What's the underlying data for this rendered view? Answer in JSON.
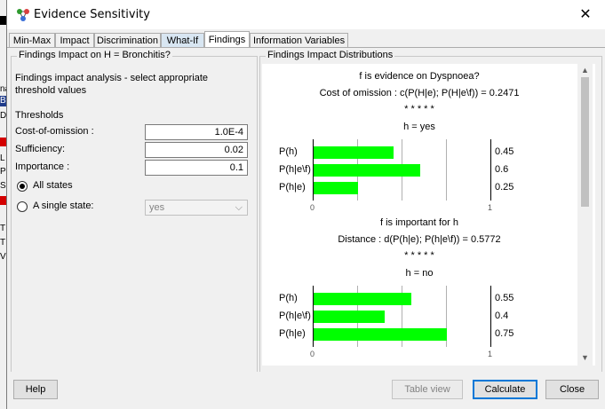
{
  "window": {
    "title": "Evidence Sensitivity",
    "close_glyph": "✕"
  },
  "background": {
    "letters": [
      "na",
      "Bi",
      "D",
      "",
      "L",
      "Pi",
      "Si",
      "",
      "T",
      "T",
      "V"
    ]
  },
  "tabs": [
    {
      "label": "Min-Max"
    },
    {
      "label": "Impact"
    },
    {
      "label": "Discrimination"
    },
    {
      "label": "What-If"
    },
    {
      "label": "Findings",
      "selected": true
    },
    {
      "label": "Information Variables"
    }
  ],
  "left_panel": {
    "title": "Findings Impact on H = Bronchitis?",
    "description": "Findings impact analysis - select appropriate threshold values",
    "thresholds_label": "Thresholds",
    "cost_of_omission": {
      "label": "Cost-of-omission :",
      "value": "1.0E-4"
    },
    "sufficiency": {
      "label": "Sufficiency:",
      "value": "0.02"
    },
    "importance": {
      "label": "Importance :",
      "value": "0.1"
    },
    "all_states": {
      "label": "All states",
      "selected": true
    },
    "single_state": {
      "label": "A single state:",
      "selected": false,
      "value": "yes"
    }
  },
  "right_panel": {
    "title": "Findings Impact Distributions",
    "sections": [
      {
        "heading": "f is evidence on Dyspnoea?",
        "metric": "Cost of omission : c(P(H|e); P(H|e\\f)) = 0.2471",
        "stars": "* * * * *",
        "state": "h = yes",
        "rows": [
          {
            "label": "P(h)",
            "value": 0.45,
            "value_text": "0.45"
          },
          {
            "label": "P(h|e\\f)",
            "value": 0.6,
            "value_text": "0.6"
          },
          {
            "label": "P(h|e)",
            "value": 0.25,
            "value_text": "0.25"
          }
        ],
        "axis_min": "0",
        "axis_max": "1"
      },
      {
        "heading": "f is important for h",
        "metric": "Distance : d(P(h|e); P(h|e\\f)) = 0.5772",
        "stars": "* * * * *",
        "state": "h = no",
        "rows": [
          {
            "label": "P(h)",
            "value": 0.55,
            "value_text": "0.55"
          },
          {
            "label": "P(h|e\\f)",
            "value": 0.4,
            "value_text": "0.4"
          },
          {
            "label": "P(h|e)",
            "value": 0.75,
            "value_text": "0.75"
          }
        ],
        "axis_min": "0",
        "axis_max": "1"
      }
    ],
    "bar_color": "#00ff00"
  },
  "buttons": {
    "help": "Help",
    "table_view": "Table view",
    "calculate": "Calculate",
    "close": "Close"
  },
  "colors": {
    "accent": "#0078d7",
    "bar": "#00ff00"
  }
}
